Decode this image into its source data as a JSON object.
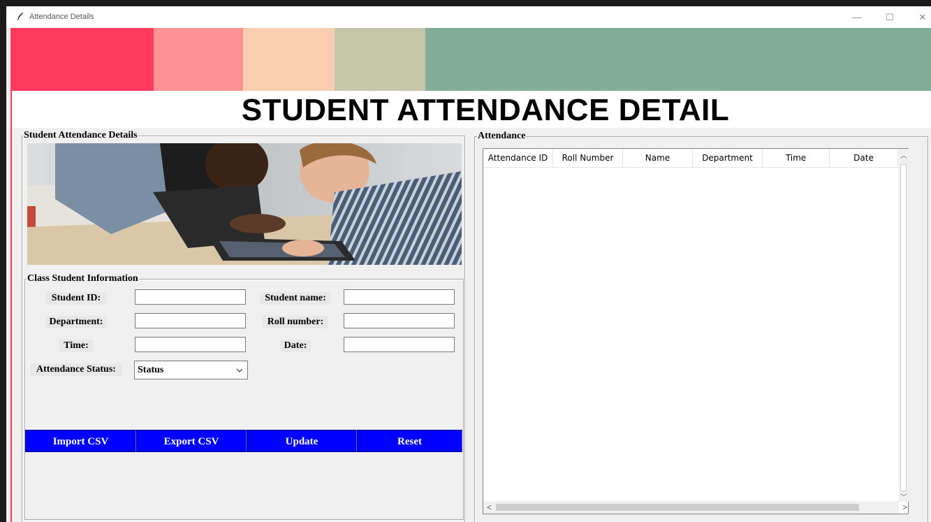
{
  "window": {
    "title": "Attendance Details",
    "controls": {
      "minimize": "—",
      "maximize": "☐",
      "close": "✕"
    }
  },
  "banner_colors": [
    "#ff3a5f",
    "#fe9393",
    "#f9cdb0",
    "#c6c7a8",
    "#84ad99"
  ],
  "heading": "STUDENT ATTENDANCE DETAIL",
  "student_frame": {
    "title": "Student Attendance Details",
    "class_info": {
      "title": "Class Student Information",
      "fields": {
        "student_id": {
          "label": "Student ID:",
          "value": ""
        },
        "student_name": {
          "label": "Student name:",
          "value": ""
        },
        "department": {
          "label": "Department:",
          "value": ""
        },
        "roll_number": {
          "label": "Roll number:",
          "value": ""
        },
        "time": {
          "label": "Time:",
          "value": ""
        },
        "date": {
          "label": "Date:",
          "value": ""
        },
        "attendance_status": {
          "label": "Attendance Status:",
          "value": "Status"
        }
      },
      "buttons": {
        "import": "Import CSV",
        "export": "Export CSV",
        "update": "Update",
        "reset": "Reset"
      }
    },
    "button_color": "#0000ff"
  },
  "attendance_frame": {
    "title": "Attendance",
    "columns": [
      "Attendance ID",
      "Roll Number",
      "Name",
      "Department",
      "Time",
      "Date"
    ],
    "rows": []
  }
}
